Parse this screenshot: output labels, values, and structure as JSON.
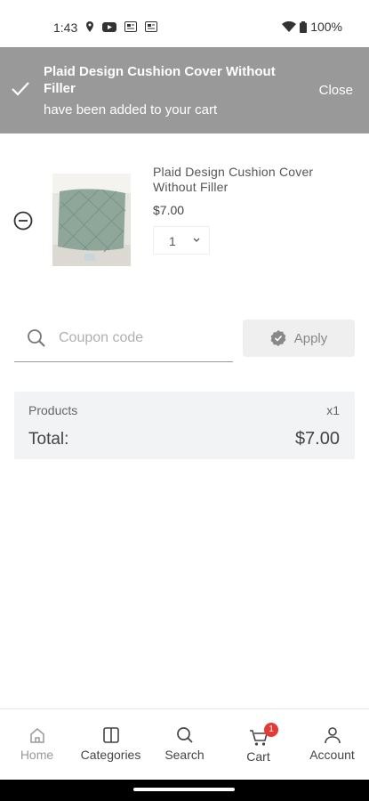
{
  "status_bar": {
    "time": "1:43",
    "battery": "100%"
  },
  "toast": {
    "title": "Plaid Design Cushion Cover Without Filler",
    "subtitle": "have been added to your cart",
    "close_label": "Close"
  },
  "cart_item": {
    "name": "Plaid Design Cushion Cover Without Filler",
    "price": "$7.00",
    "quantity": "1"
  },
  "coupon": {
    "placeholder": "Coupon code",
    "apply_label": "Apply"
  },
  "summary": {
    "products_label": "Products",
    "products_count": "x1",
    "total_label": "Total:",
    "total_value": "$7.00"
  },
  "bottom_nav": {
    "items": [
      {
        "label": "Home",
        "icon": "home-icon"
      },
      {
        "label": "Categories",
        "icon": "categories-icon"
      },
      {
        "label": "Search",
        "icon": "search-icon"
      },
      {
        "label": "Cart",
        "icon": "cart-icon",
        "badge": "1"
      },
      {
        "label": "Account",
        "icon": "account-icon"
      }
    ]
  },
  "colors": {
    "toast_bg": "#999999",
    "summary_bg": "#f1f3f5",
    "badge": "#e53935"
  }
}
